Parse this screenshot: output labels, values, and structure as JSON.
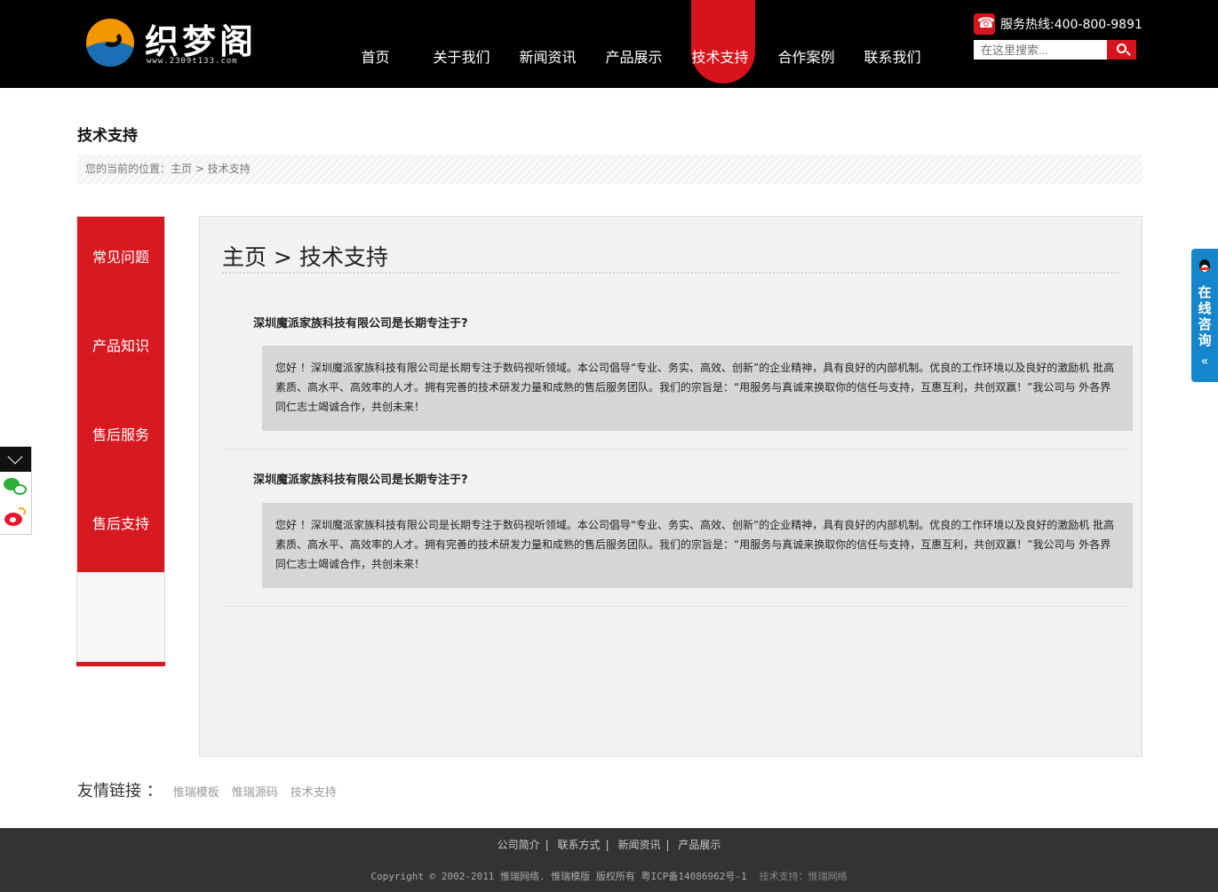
{
  "header": {
    "logo_text": "织梦阁",
    "logo_subtext": "www.2309t133.com",
    "nav": [
      {
        "label": "首页",
        "active": false
      },
      {
        "label": "关于我们",
        "active": false
      },
      {
        "label": "新闻资讯",
        "active": false
      },
      {
        "label": "产品展示",
        "active": false
      },
      {
        "label": "技术支持",
        "active": true
      },
      {
        "label": "合作案例",
        "active": false
      },
      {
        "label": "联系我们",
        "active": false
      }
    ],
    "hotline": "服务热线:400-800-9891",
    "search_placeholder": "在这里搜索..."
  },
  "page": {
    "title": "技术支持",
    "breadcrumb": "您的当前的位置：主页 > 技术支持"
  },
  "sidebar": {
    "items": [
      "常见问题",
      "产品知识",
      "售后服务",
      "售后支持"
    ]
  },
  "main": {
    "heading": "主页 > 技术支持",
    "qa": [
      {
        "question": "深圳魔派家族科技有限公司是长期专注于?",
        "answer": "您好 ！深圳魔派家族科技有限公司是长期专注于数码视听领域。本公司倡导“专业、务实、高效、创新”的企业精神，具有良好的内部机制。优良的工作环境以及良好的激励机 批高素质、高水平、高效率的人才。拥有完善的技术研发力量和成熟的售后服务团队。我们的宗旨是：“用服务与真诚来换取你的信任与支持，互惠互利，共创双赢！”我公司与 外各界同仁志士竭诚合作，共创未来！"
      },
      {
        "question": "深圳魔派家族科技有限公司是长期专注于?",
        "answer": "您好 ！深圳魔派家族科技有限公司是长期专注于数码视听领域。本公司倡导“专业、务实、高效、创新”的企业精神，具有良好的内部机制。优良的工作环境以及良好的激励机 批高素质、高水平、高效率的人才。拥有完善的技术研发力量和成熟的售后服务团队。我们的宗旨是：“用服务与真诚来换取你的信任与支持，互惠互利，共创双赢！”我公司与 外各界同仁志士竭诚合作，共创未来！"
      }
    ]
  },
  "friend_links": {
    "title": "友情链接 ：",
    "links": [
      "惟瑞模板",
      "惟瑞源码",
      "技术支持"
    ]
  },
  "footer": {
    "nav": [
      "公司简介",
      "联系方式",
      "新闻资讯",
      "产品展示"
    ],
    "separator": "|",
    "copyright": "Copyright © 2002-2011 惟瑞网络. 惟瑞模版 版权所有 粤ICP备14086962号-1",
    "tech_support": "技术支持：惟瑞网络"
  },
  "consult": {
    "label": "在线咨询",
    "arrow": "«"
  },
  "colors": {
    "brand_red": "#d7141d",
    "header_bg": "#000000",
    "footer_bg": "#333333",
    "consult_blue": "#1686cc"
  },
  "icons": [
    "phone-icon",
    "search-icon",
    "chevron-down-icon",
    "wechat-icon",
    "weibo-icon",
    "qq-icon"
  ]
}
